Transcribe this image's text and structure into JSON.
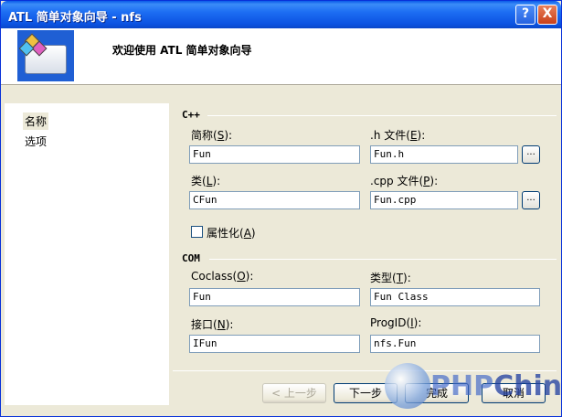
{
  "window": {
    "title": "ATL 简单对象向导 - nfs",
    "help_label": "?",
    "close_label": "X"
  },
  "header": {
    "title": "欢迎使用 ATL 简单对象向导"
  },
  "nav": {
    "items": [
      {
        "label": "名称",
        "selected": true
      },
      {
        "label": "选项",
        "selected": false
      }
    ]
  },
  "cpp_group": {
    "label": "C++",
    "short_name_label": "简称",
    "short_name_key": "S",
    "short_name_value": "Fun",
    "h_file_label": ".h 文件",
    "h_file_key": "E",
    "h_file_value": "Fun.h",
    "class_label": "类",
    "class_key": "L",
    "class_value": "CFun",
    "cpp_file_label": ".cpp 文件",
    "cpp_file_key": "P",
    "cpp_file_value": "Fun.cpp",
    "browse_label": "...",
    "attributed_label": "属性化",
    "attributed_key": "A",
    "attributed_checked": false
  },
  "com_group": {
    "label": "COM",
    "coclass_label": "Coclass",
    "coclass_key": "O",
    "coclass_value": "Fun",
    "type_label": "类型",
    "type_key": "T",
    "type_value": "Fun Class",
    "interface_label": "接口",
    "interface_key": "N",
    "interface_value": "IFun",
    "progid_label": "ProgID",
    "progid_key": "I",
    "progid_value": "nfs.Fun"
  },
  "buttons": {
    "prev": "< 上一步",
    "next": "下一步",
    "finish": "完成",
    "cancel": "取消"
  },
  "watermark": {
    "part1": "PHP",
    "part2": "China"
  }
}
